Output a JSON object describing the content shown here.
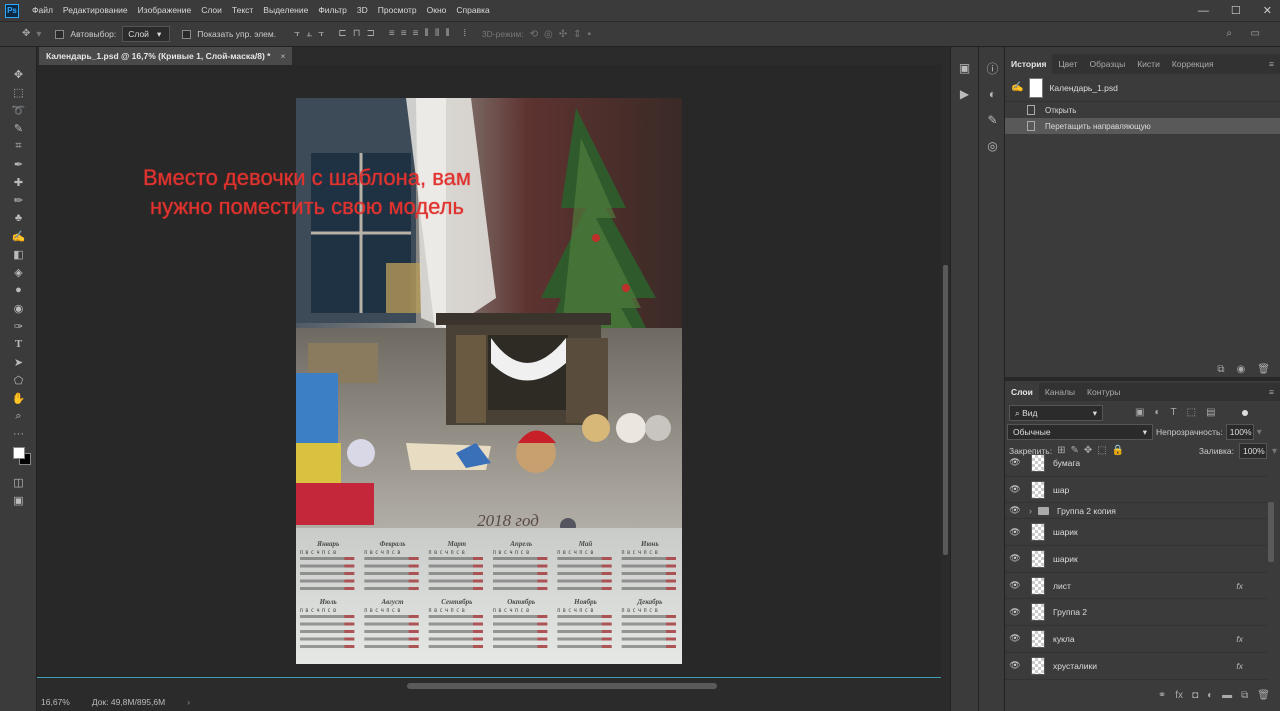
{
  "app": {
    "logo": "Ps"
  },
  "menubar": {
    "items": [
      "Файл",
      "Редактирование",
      "Изображение",
      "Слои",
      "Текст",
      "Выделение",
      "Фильтр",
      "3D",
      "Просмотр",
      "Окно",
      "Справка"
    ]
  },
  "window_controls": {
    "minimize": "—",
    "maximize": "☐",
    "close": "✕"
  },
  "options": {
    "autoselect_label": "Автовыбор:",
    "autoselect_value": "Слой",
    "show_transform_label": "Показать упр. элем.",
    "mode_3d_label": "3D-режим:"
  },
  "document": {
    "tab_title": "Календарь_1.psd @ 16,7% (Кривые 1, Слой-маска/8) *",
    "close": "×"
  },
  "annotation": {
    "line1": "Вместо девочки с шаблона, вам",
    "line2": "нужно поместить свою модель"
  },
  "calendar": {
    "year_label": "2018 год",
    "months": [
      "Январь",
      "Февраль",
      "Март",
      "Апрель",
      "Май",
      "Июнь",
      "Июль",
      "Август",
      "Сентябрь",
      "Октябрь",
      "Ноябрь",
      "Декабрь"
    ],
    "weekday_header": "П В С Ч П С В"
  },
  "status": {
    "zoom": "16,67%",
    "doc_size": "Док: 49,8M/895,6M"
  },
  "history_panel": {
    "tabs": [
      "История",
      "Цвет",
      "Образцы",
      "Кисти",
      "Коррекция"
    ],
    "snapshot": "Календарь_1.psd",
    "items": [
      "Открыть",
      "Перетащить направляющую"
    ]
  },
  "layers_panel": {
    "tabs": [
      "Слои",
      "Каналы",
      "Контуры"
    ],
    "filter_label": "Вид",
    "blend_mode": "Обычные",
    "opacity_label": "Непрозрачность:",
    "opacity_value": "100%",
    "lock_label": "Закрепить:",
    "fill_label": "Заливка:",
    "fill_value": "100%",
    "layers": [
      {
        "name": "бумага",
        "fx": "",
        "type": "layer"
      },
      {
        "name": "шар",
        "fx": "",
        "type": "layer"
      },
      {
        "name": "Группа 2 копия",
        "fx": "",
        "type": "group"
      },
      {
        "name": "шарик",
        "fx": "",
        "type": "layer"
      },
      {
        "name": "шарик",
        "fx": "",
        "type": "layer"
      },
      {
        "name": "лист",
        "fx": "fx",
        "type": "layer"
      },
      {
        "name": "Группа 2",
        "fx": "",
        "type": "layer"
      },
      {
        "name": "кукла",
        "fx": "fx",
        "type": "layer"
      },
      {
        "name": "хрусталики",
        "fx": "fx",
        "type": "layer"
      }
    ]
  }
}
